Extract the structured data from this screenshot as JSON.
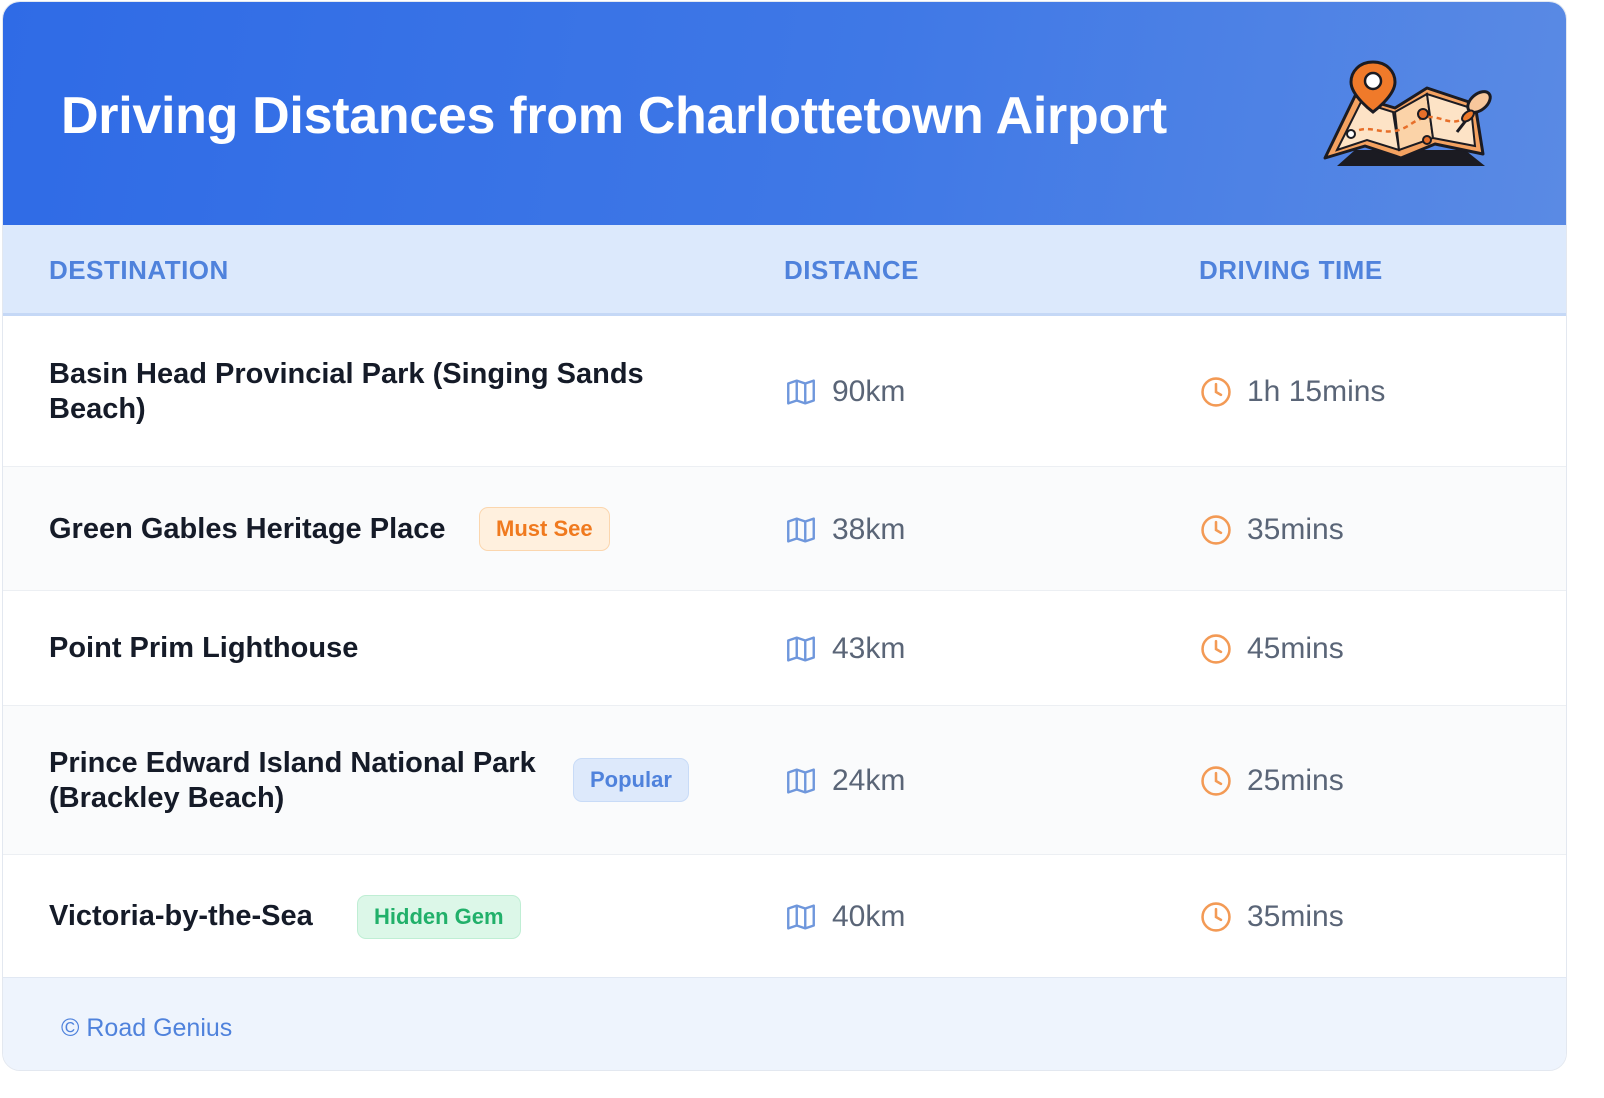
{
  "header": {
    "title": "Driving Distances from Charlottetown Airport",
    "illustration_icon": "folded-map-with-pin-icon"
  },
  "table": {
    "columns": [
      "DESTINATION",
      "DISTANCE",
      "DRIVING TIME"
    ],
    "rows": [
      {
        "destination": "Basin Head Provincial Park (Singing Sands Beach)",
        "badge": "",
        "distance": "90km",
        "time": "1h 15mins"
      },
      {
        "destination": "Green Gables Heritage Place",
        "badge": "Must See",
        "distance": "38km",
        "time": "35mins"
      },
      {
        "destination": "Point Prim Lighthouse",
        "badge": "",
        "distance": "43km",
        "time": "45mins"
      },
      {
        "destination": "Prince Edward Island National Park (Brackley Beach)",
        "badge": "Popular",
        "distance": "24km",
        "time": "25mins"
      },
      {
        "destination": "Victoria-by-the-Sea",
        "badge": "Hidden Gem",
        "distance": "40km",
        "time": "35mins"
      }
    ],
    "distance_icon": "map-icon",
    "time_icon": "clock-icon"
  },
  "footer": {
    "text": "© Road Genius"
  },
  "colors": {
    "header_start": "#2f6be6",
    "header_end": "#5a8ae4",
    "accent_blue": "#4f82dc",
    "accent_orange": "#f07a1f",
    "accent_green": "#21b06a"
  }
}
